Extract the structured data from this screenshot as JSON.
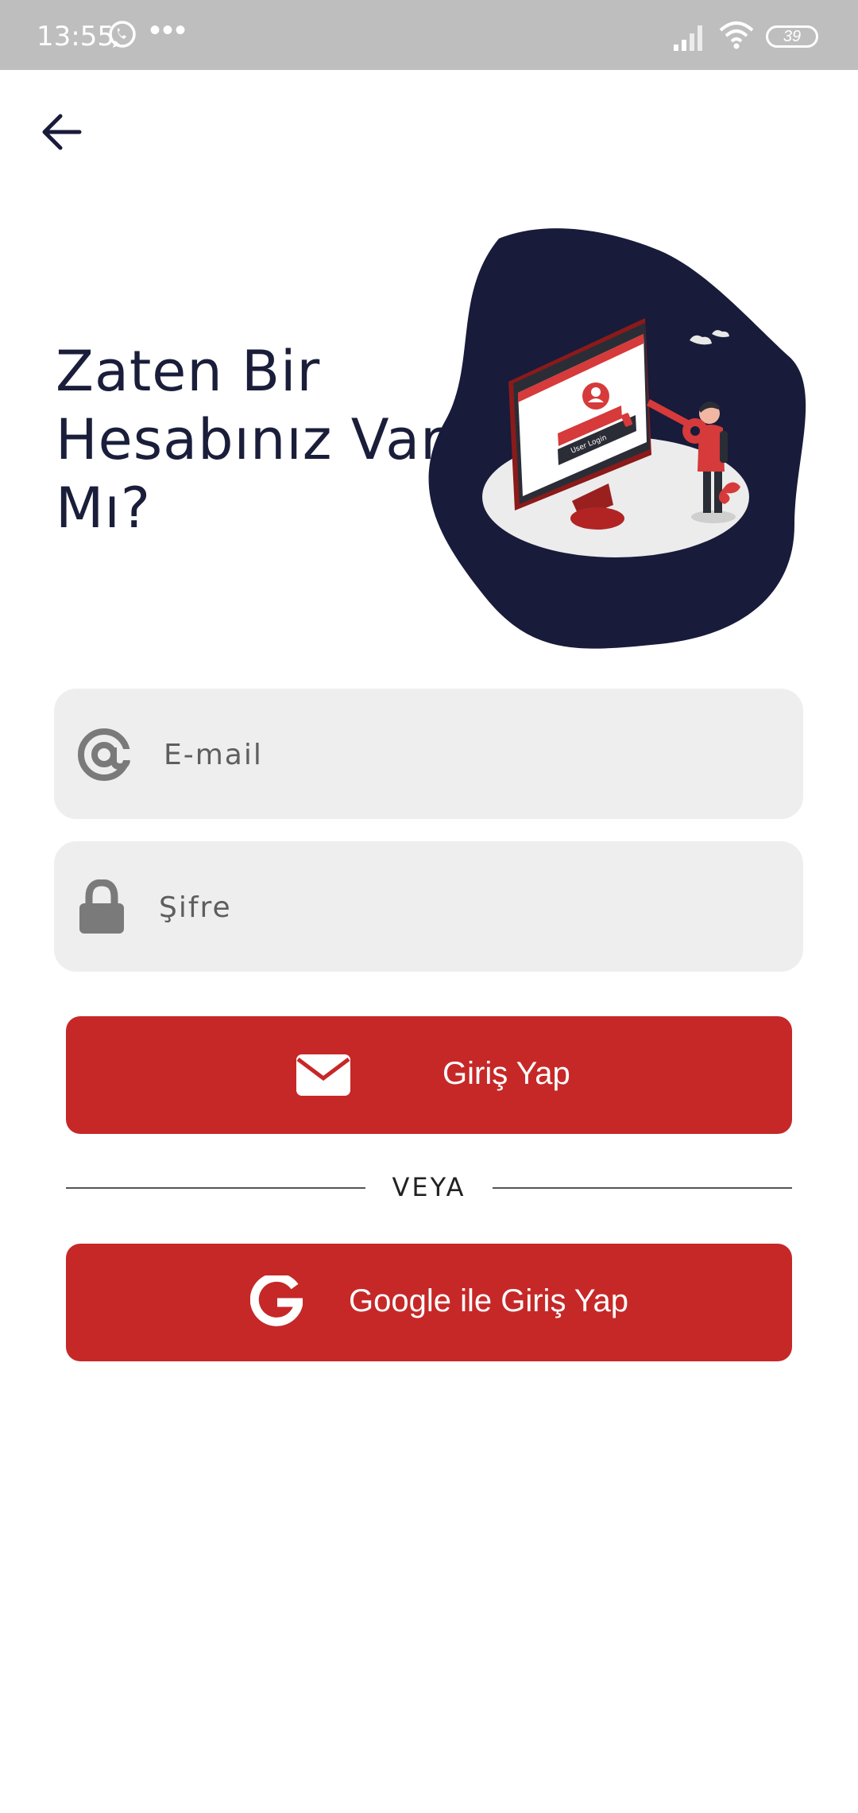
{
  "status_bar": {
    "time": "13:55",
    "battery": "39",
    "icons": [
      "whatsapp-icon",
      "more-dots-icon",
      "signal-icon",
      "wifi-icon",
      "battery-icon"
    ]
  },
  "header": {
    "back_icon": "arrow-left-icon"
  },
  "title": {
    "line1": "Zaten Bir",
    "line2": "Hesabınız Var",
    "line3": "Mı?"
  },
  "form": {
    "email": {
      "placeholder": "E-mail",
      "value": "",
      "icon": "at-sign-icon"
    },
    "password": {
      "placeholder": "Şifre",
      "value": "",
      "icon": "lock-icon"
    }
  },
  "login_button": {
    "label": "Giriş Yap",
    "icon": "envelope-icon"
  },
  "divider": {
    "label": "VEYA"
  },
  "google_button": {
    "label": "Google ile Giriş Yap",
    "icon": "google-icon"
  },
  "illustration": {
    "screen_text": "User Login"
  },
  "colors": {
    "accent": "#c62828",
    "dark_navy": "#181b3a",
    "field_bg": "#eeeeee",
    "statusbar": "#bebebe"
  }
}
